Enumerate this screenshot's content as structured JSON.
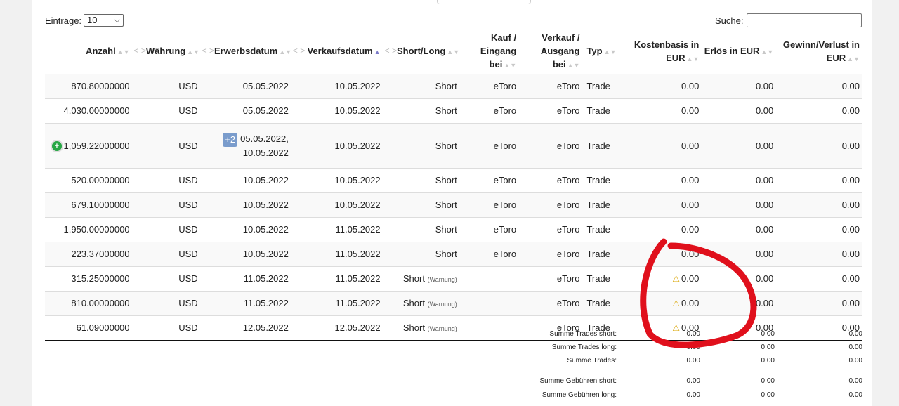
{
  "controls": {
    "entries_label": "Einträge:",
    "entries_value": "10",
    "search_label": "Suche:",
    "search_value": ""
  },
  "columns": [
    "Anzahl",
    "Währung",
    "Erwerbsdatum",
    "Verkaufsdatum",
    "Short/Long",
    "Kauf / Eingang bei",
    "Verkauf / Ausgang bei",
    "Typ",
    "Kostenbasis in EUR",
    "Erlös in EUR",
    "Gewinn/Verlust in EUR"
  ],
  "drag_glyph": "< >",
  "warning_note": "(Warnung)",
  "plus_badge": "+2",
  "expand_glyph": "+",
  "rows": [
    {
      "anzahl": "870.80000000",
      "waehrung": "USD",
      "erwerb": "05.05.2022",
      "verkauf": "10.05.2022",
      "sl": "Short",
      "kauf": "eToro",
      "ausgang": "eToro",
      "typ": "Trade",
      "kosten": "0.00",
      "erloes": "0.00",
      "gv": "0.00"
    },
    {
      "anzahl": "4,030.00000000",
      "waehrung": "USD",
      "erwerb": "05.05.2022",
      "verkauf": "10.05.2022",
      "sl": "Short",
      "kauf": "eToro",
      "ausgang": "eToro",
      "typ": "Trade",
      "kosten": "0.00",
      "erloes": "0.00",
      "gv": "0.00"
    },
    {
      "anzahl": "1,059.22000000",
      "waehrung": "USD",
      "erwerb_a": "05.05.2022,",
      "erwerb_b": "10.05.2022",
      "verkauf": "10.05.2022",
      "sl": "Short",
      "kauf": "eToro",
      "ausgang": "eToro",
      "typ": "Trade",
      "kosten": "0.00",
      "erloes": "0.00",
      "gv": "0.00"
    },
    {
      "anzahl": "520.00000000",
      "waehrung": "USD",
      "erwerb": "10.05.2022",
      "verkauf": "10.05.2022",
      "sl": "Short",
      "kauf": "eToro",
      "ausgang": "eToro",
      "typ": "Trade",
      "kosten": "0.00",
      "erloes": "0.00",
      "gv": "0.00"
    },
    {
      "anzahl": "679.10000000",
      "waehrung": "USD",
      "erwerb": "10.05.2022",
      "verkauf": "10.05.2022",
      "sl": "Short",
      "kauf": "eToro",
      "ausgang": "eToro",
      "typ": "Trade",
      "kosten": "0.00",
      "erloes": "0.00",
      "gv": "0.00"
    },
    {
      "anzahl": "1,950.00000000",
      "waehrung": "USD",
      "erwerb": "10.05.2022",
      "verkauf": "11.05.2022",
      "sl": "Short",
      "kauf": "eToro",
      "ausgang": "eToro",
      "typ": "Trade",
      "kosten": "0.00",
      "erloes": "0.00",
      "gv": "0.00"
    },
    {
      "anzahl": "223.37000000",
      "waehrung": "USD",
      "erwerb": "10.05.2022",
      "verkauf": "11.05.2022",
      "sl": "Short",
      "kauf": "eToro",
      "ausgang": "eToro",
      "typ": "Trade",
      "kosten": "0.00",
      "erloes": "0.00",
      "gv": "0.00"
    },
    {
      "anzahl": "315.25000000",
      "waehrung": "USD",
      "erwerb": "11.05.2022",
      "verkauf": "11.05.2022",
      "sl": "Short",
      "kauf": "",
      "ausgang": "eToro",
      "typ": "Trade",
      "kosten": "0.00",
      "erloes": "0.00",
      "gv": "0.00"
    },
    {
      "anzahl": "810.00000000",
      "waehrung": "USD",
      "erwerb": "11.05.2022",
      "verkauf": "11.05.2022",
      "sl": "Short",
      "kauf": "",
      "ausgang": "eToro",
      "typ": "Trade",
      "kosten": "0.00",
      "erloes": "0.00",
      "gv": "0.00"
    },
    {
      "anzahl": "61.09000000",
      "waehrung": "USD",
      "erwerb": "12.05.2022",
      "verkauf": "12.05.2022",
      "sl": "Short",
      "kauf": "",
      "ausgang": "eToro",
      "typ": "Trade",
      "kosten": "0.00",
      "erloes": "0.00",
      "gv": "0.00"
    }
  ],
  "summary": [
    {
      "label": "Summe Trades short:",
      "v1": "0.00",
      "v2": "0.00",
      "v3": "0.00"
    },
    {
      "label": "Summe Trades long:",
      "v1": "0.00",
      "v2": "0.00",
      "v3": "0.00"
    },
    {
      "label": "Summe Trades:",
      "v1": "0.00",
      "v2": "0.00",
      "v3": "0.00"
    },
    {
      "label": "Summe Gebühren short:",
      "v1": "0.00",
      "v2": "0.00",
      "v3": "0.00"
    },
    {
      "label": "Summe Gebühren long:",
      "v1": "0.00",
      "v2": "0.00",
      "v3": "0.00"
    }
  ],
  "colors": {
    "annotation": "#e0101c",
    "warning": "#d9a400",
    "expand": "#28a745",
    "badge": "#7a9ccc"
  }
}
